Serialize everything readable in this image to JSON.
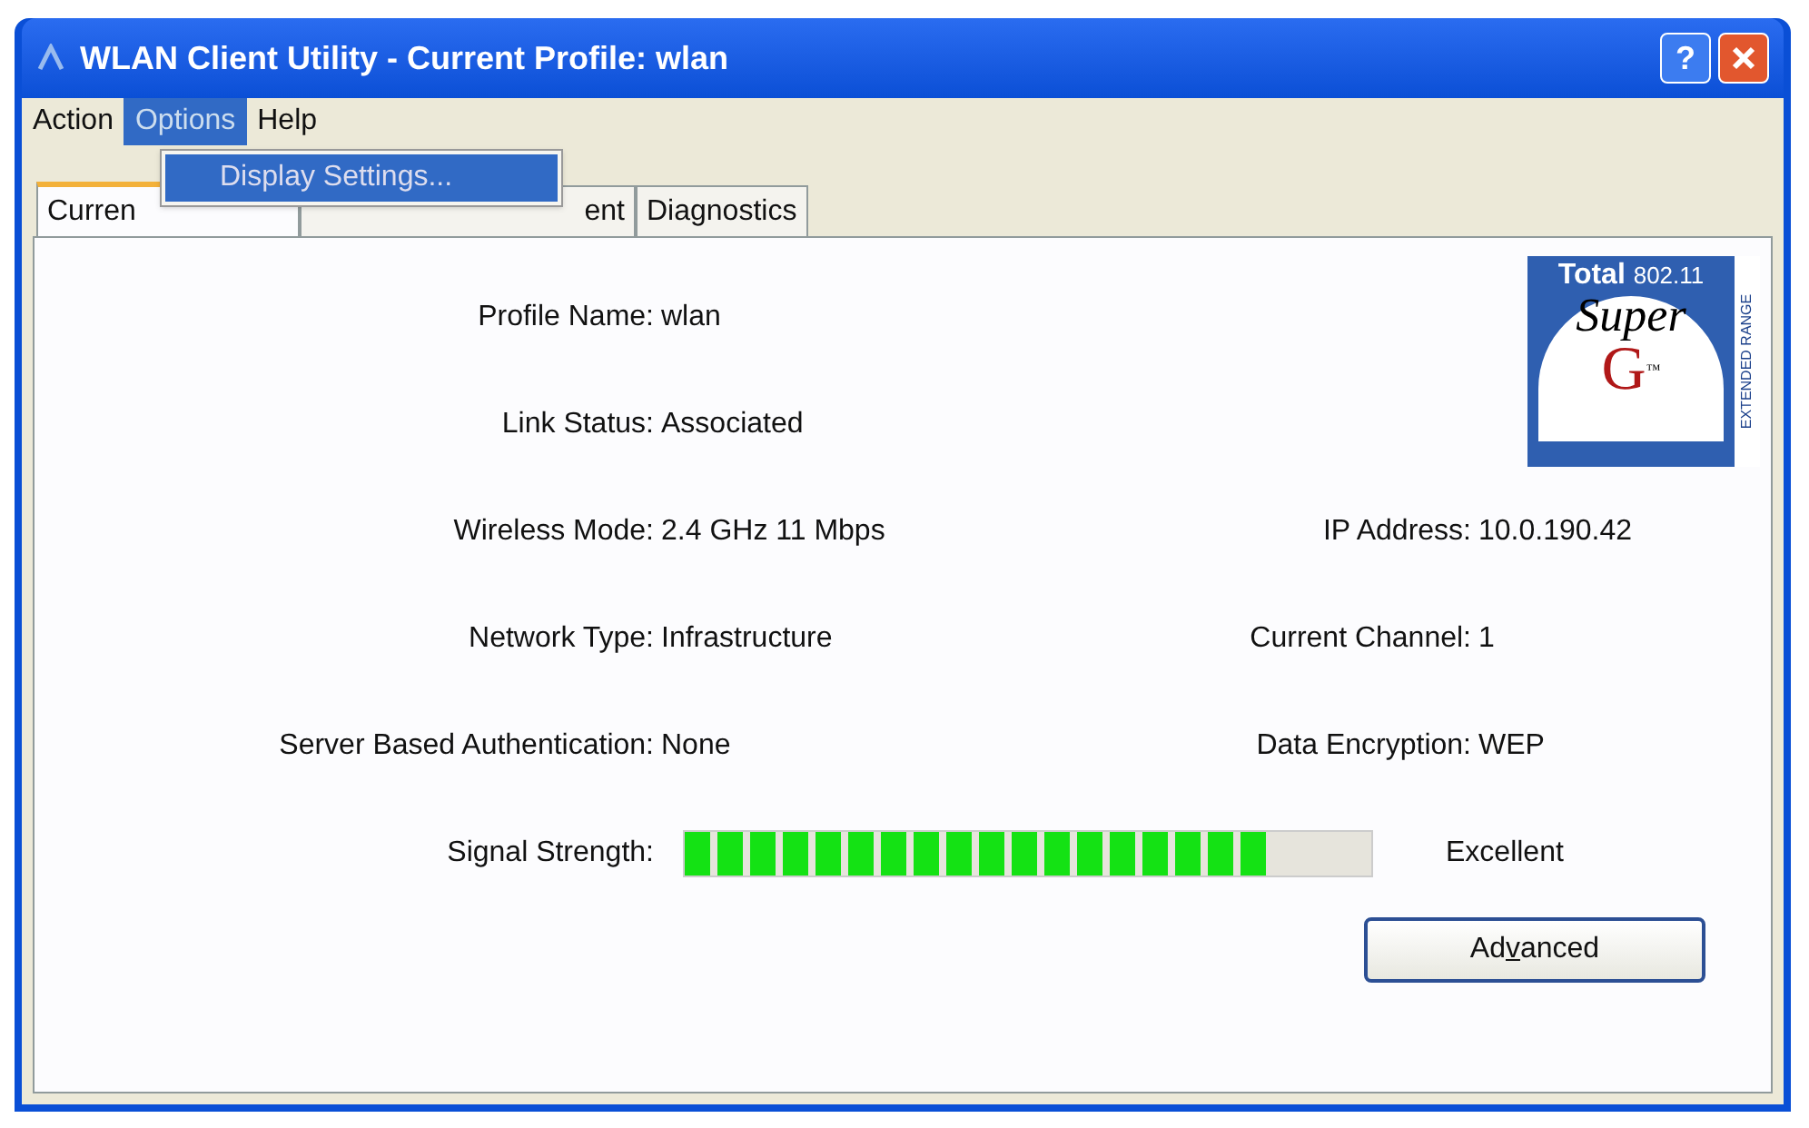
{
  "window": {
    "title": "WLAN Client Utility - Current Profile: wlan",
    "help_button": "?"
  },
  "menu_bar": [
    {
      "label": "Action",
      "selected": false
    },
    {
      "label": "Options",
      "selected": true
    },
    {
      "label": "Help",
      "selected": false
    }
  ],
  "open_menu": {
    "items": [
      {
        "label": "Display Settings...",
        "selected": true
      }
    ]
  },
  "tabs": [
    {
      "label": "Curren",
      "selected": true
    },
    {
      "label": "ent",
      "selected": false
    },
    {
      "label": "Diagnostics",
      "selected": false
    }
  ],
  "logo": {
    "brand": "Total",
    "standard": "802.11",
    "script": "Super",
    "letter": "G",
    "mark": "™",
    "side": "EXTENDED RANGE"
  },
  "fields_left": [
    {
      "label": "Profile Name:",
      "value": "wlan"
    },
    {
      "label": "Link Status:",
      "value": "Associated"
    },
    {
      "label": "Wireless Mode:",
      "value": "2.4 GHz 11 Mbps"
    },
    {
      "label": "Network Type:",
      "value": "Infrastructure"
    },
    {
      "label": "Server Based Authentication:",
      "value": "None"
    }
  ],
  "fields_right": [
    {
      "label": "IP Address:",
      "value": "10.0.190.42"
    },
    {
      "label": "Current Channel:",
      "value": "1"
    },
    {
      "label": "Data Encryption:",
      "value": "WEP"
    }
  ],
  "signal": {
    "label": "Signal Strength:",
    "level": 0.87,
    "reading": "Excellent"
  },
  "advanced_button": {
    "label": "Advanced"
  }
}
